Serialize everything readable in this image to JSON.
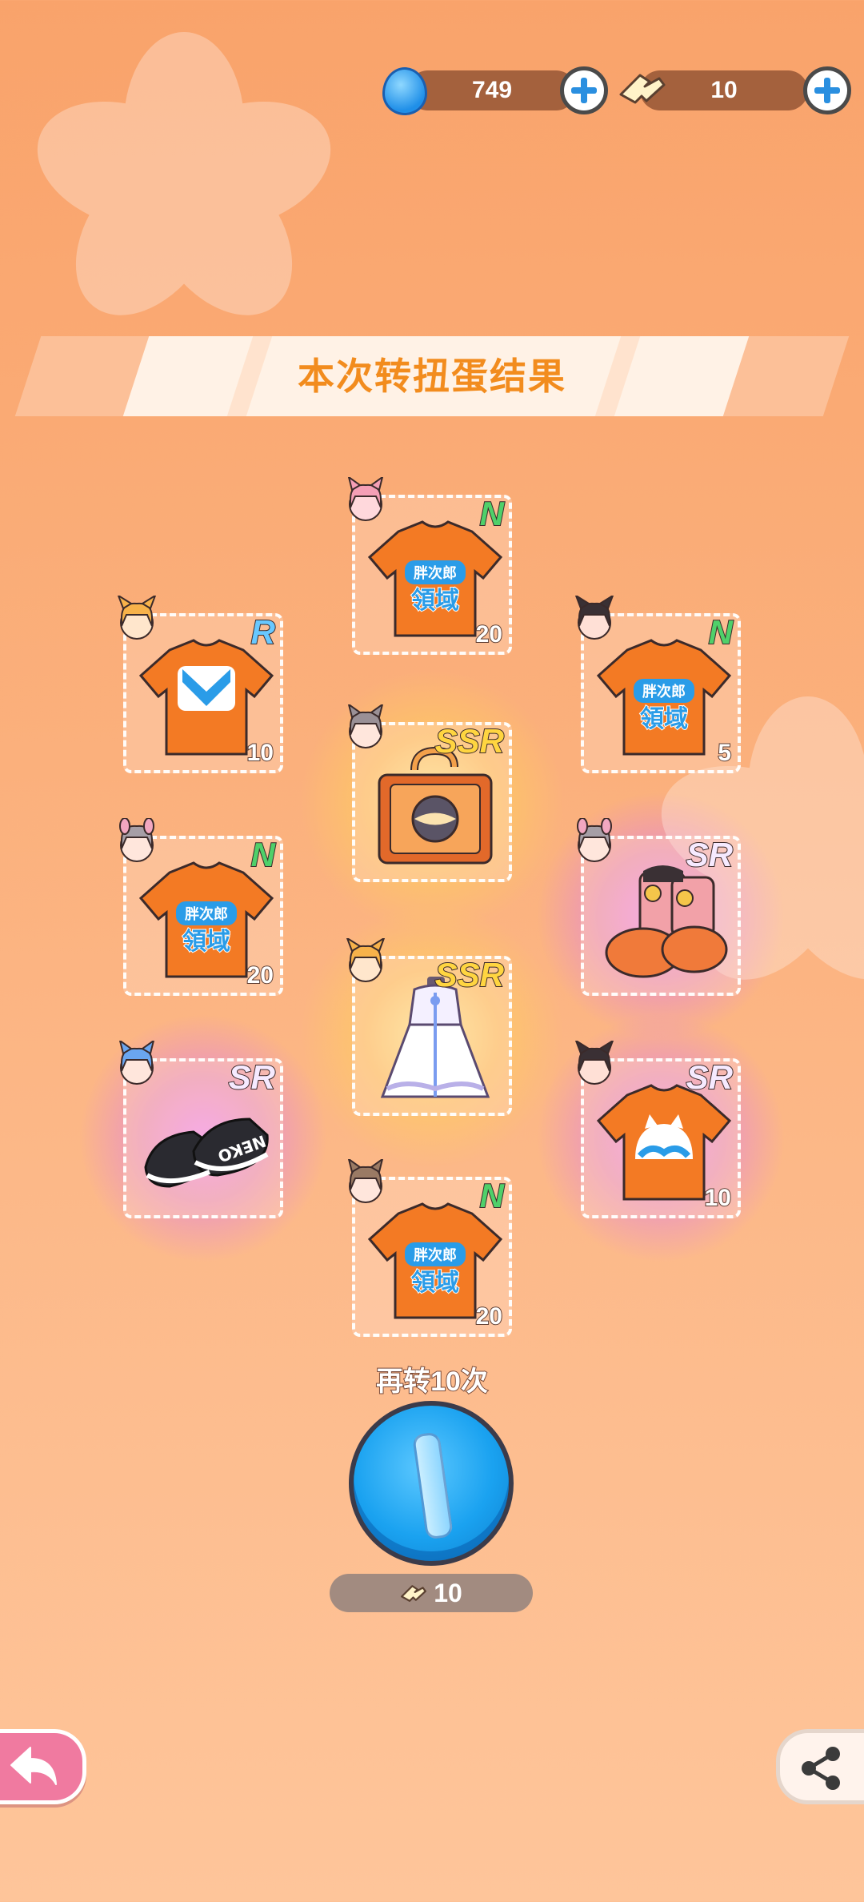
{
  "currency": {
    "gems": {
      "icon": "blue-gem-icon",
      "value": "749"
    },
    "coupons": {
      "icon": "gacha-coupon-icon",
      "value": "10"
    }
  },
  "title": "本次转扭蛋结果",
  "results": [
    {
      "name": "orange-tshirt",
      "rarity": "N",
      "count": "20",
      "avatar": "pink-cat-girl"
    },
    {
      "name": "sailor-tshirt",
      "rarity": "R",
      "count": "10",
      "avatar": "blonde-fox-girl"
    },
    {
      "name": "orange-tshirt",
      "rarity": "N",
      "count": "5",
      "avatar": "dark-fox-girl"
    },
    {
      "name": "treasure-chest",
      "rarity": "SSR",
      "count": "",
      "avatar": "grey-cat-girl"
    },
    {
      "name": "orange-tshirt",
      "rarity": "N",
      "count": "20",
      "avatar": "grey-bunny-girl"
    },
    {
      "name": "pumpkin-boots",
      "rarity": "SR",
      "count": "",
      "avatar": "grey-bunny-girl"
    },
    {
      "name": "white-lace-dress",
      "rarity": "SSR",
      "count": "",
      "avatar": "blonde-fox-girl"
    },
    {
      "name": "neko-sneakers",
      "rarity": "SR",
      "count": "",
      "avatar": "blue-cat-girl"
    },
    {
      "name": "cat-logo-tshirt",
      "rarity": "SR",
      "count": "10",
      "avatar": "dark-fox-girl"
    },
    {
      "name": "orange-tshirt",
      "rarity": "N",
      "count": "20",
      "avatar": "brown-bunny-girl"
    }
  ],
  "shirt_text": {
    "line1": "胖次郎",
    "line2": "領域"
  },
  "sneaker_text": "NEKO",
  "spin_again": {
    "label": "再转10次",
    "cost": "10"
  },
  "colors": {
    "accent": "#f28c1e",
    "spin": "#1aa2f0",
    "back": "#f07aa0"
  }
}
